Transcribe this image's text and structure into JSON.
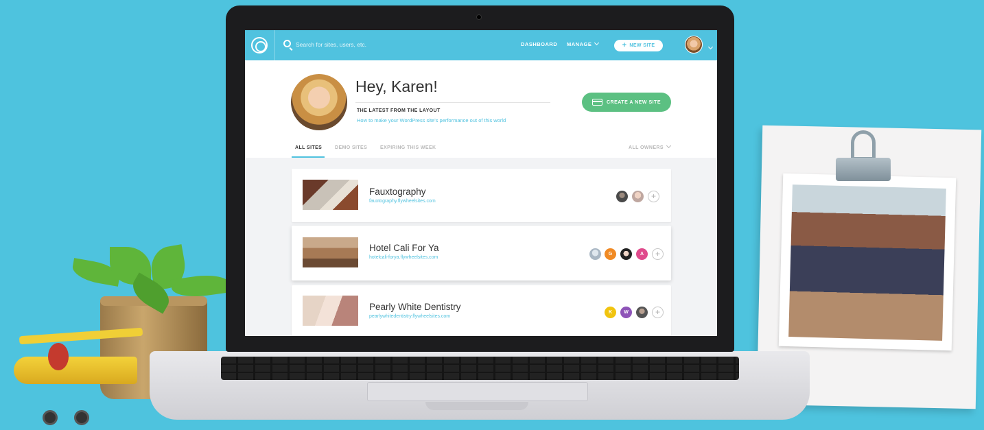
{
  "app": {
    "logo_icon": "flywheel-logo-icon",
    "accent": "#50c2df",
    "green": "#5cc082"
  },
  "topbar": {
    "search_placeholder": "Search for sites, users, etc.",
    "nav": {
      "dashboard": "DASHBOARD",
      "manage": "MANAGE"
    },
    "new_site_label": "NEW SITE"
  },
  "welcome": {
    "greeting": "Hey, Karen!",
    "latest_label": "THE LATEST FROM THE LAYOUT",
    "latest_link": "How to make your WordPress site's performance out of this world",
    "create_button": "CREATE A NEW SITE"
  },
  "tabs": {
    "all": "ALL SITES",
    "demo": "DEMO SITES",
    "expiring": "EXPIRING THIS WEEK",
    "owners": "ALL OWNERS"
  },
  "sites": [
    {
      "name": "Fauxtography",
      "url": "fauxtography.flywheelsites.com"
    },
    {
      "name": "Hotel Cali For Ya",
      "url": "hotelcali-forya.flywheelsites.com",
      "owner_initials": [
        "G",
        "A"
      ]
    },
    {
      "name": "Pearly White Dentistry",
      "url": "pearlywhitedentistry.flywheelsites.com",
      "owner_initials": [
        "K",
        "W"
      ]
    }
  ],
  "owner_colors": {
    "G": "#f08a24",
    "A": "#e04a8c",
    "K": "#f1c40f",
    "W": "#8e54b8"
  }
}
